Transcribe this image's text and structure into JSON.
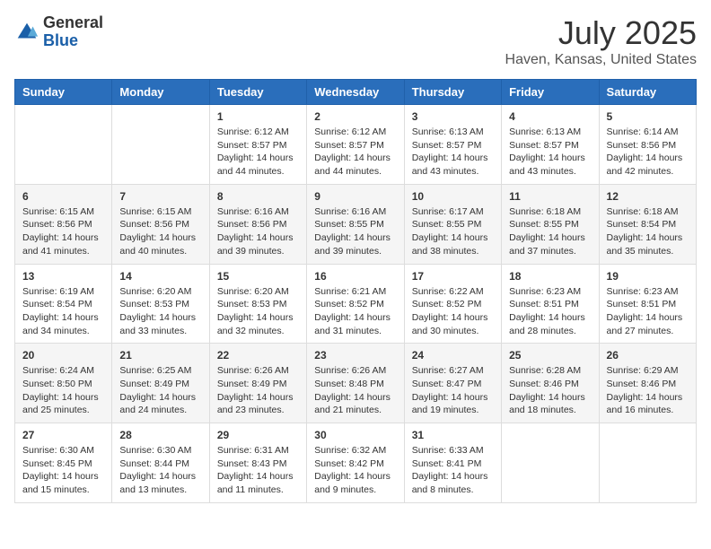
{
  "logo": {
    "general": "General",
    "blue": "Blue"
  },
  "title": "July 2025",
  "subtitle": "Haven, Kansas, United States",
  "days_of_week": [
    "Sunday",
    "Monday",
    "Tuesday",
    "Wednesday",
    "Thursday",
    "Friday",
    "Saturday"
  ],
  "weeks": [
    [
      {
        "day": "",
        "content": ""
      },
      {
        "day": "",
        "content": ""
      },
      {
        "day": "1",
        "content": "Sunrise: 6:12 AM\nSunset: 8:57 PM\nDaylight: 14 hours and 44 minutes."
      },
      {
        "day": "2",
        "content": "Sunrise: 6:12 AM\nSunset: 8:57 PM\nDaylight: 14 hours and 44 minutes."
      },
      {
        "day": "3",
        "content": "Sunrise: 6:13 AM\nSunset: 8:57 PM\nDaylight: 14 hours and 43 minutes."
      },
      {
        "day": "4",
        "content": "Sunrise: 6:13 AM\nSunset: 8:57 PM\nDaylight: 14 hours and 43 minutes."
      },
      {
        "day": "5",
        "content": "Sunrise: 6:14 AM\nSunset: 8:56 PM\nDaylight: 14 hours and 42 minutes."
      }
    ],
    [
      {
        "day": "6",
        "content": "Sunrise: 6:15 AM\nSunset: 8:56 PM\nDaylight: 14 hours and 41 minutes."
      },
      {
        "day": "7",
        "content": "Sunrise: 6:15 AM\nSunset: 8:56 PM\nDaylight: 14 hours and 40 minutes."
      },
      {
        "day": "8",
        "content": "Sunrise: 6:16 AM\nSunset: 8:56 PM\nDaylight: 14 hours and 39 minutes."
      },
      {
        "day": "9",
        "content": "Sunrise: 6:16 AM\nSunset: 8:55 PM\nDaylight: 14 hours and 39 minutes."
      },
      {
        "day": "10",
        "content": "Sunrise: 6:17 AM\nSunset: 8:55 PM\nDaylight: 14 hours and 38 minutes."
      },
      {
        "day": "11",
        "content": "Sunrise: 6:18 AM\nSunset: 8:55 PM\nDaylight: 14 hours and 37 minutes."
      },
      {
        "day": "12",
        "content": "Sunrise: 6:18 AM\nSunset: 8:54 PM\nDaylight: 14 hours and 35 minutes."
      }
    ],
    [
      {
        "day": "13",
        "content": "Sunrise: 6:19 AM\nSunset: 8:54 PM\nDaylight: 14 hours and 34 minutes."
      },
      {
        "day": "14",
        "content": "Sunrise: 6:20 AM\nSunset: 8:53 PM\nDaylight: 14 hours and 33 minutes."
      },
      {
        "day": "15",
        "content": "Sunrise: 6:20 AM\nSunset: 8:53 PM\nDaylight: 14 hours and 32 minutes."
      },
      {
        "day": "16",
        "content": "Sunrise: 6:21 AM\nSunset: 8:52 PM\nDaylight: 14 hours and 31 minutes."
      },
      {
        "day": "17",
        "content": "Sunrise: 6:22 AM\nSunset: 8:52 PM\nDaylight: 14 hours and 30 minutes."
      },
      {
        "day": "18",
        "content": "Sunrise: 6:23 AM\nSunset: 8:51 PM\nDaylight: 14 hours and 28 minutes."
      },
      {
        "day": "19",
        "content": "Sunrise: 6:23 AM\nSunset: 8:51 PM\nDaylight: 14 hours and 27 minutes."
      }
    ],
    [
      {
        "day": "20",
        "content": "Sunrise: 6:24 AM\nSunset: 8:50 PM\nDaylight: 14 hours and 25 minutes."
      },
      {
        "day": "21",
        "content": "Sunrise: 6:25 AM\nSunset: 8:49 PM\nDaylight: 14 hours and 24 minutes."
      },
      {
        "day": "22",
        "content": "Sunrise: 6:26 AM\nSunset: 8:49 PM\nDaylight: 14 hours and 23 minutes."
      },
      {
        "day": "23",
        "content": "Sunrise: 6:26 AM\nSunset: 8:48 PM\nDaylight: 14 hours and 21 minutes."
      },
      {
        "day": "24",
        "content": "Sunrise: 6:27 AM\nSunset: 8:47 PM\nDaylight: 14 hours and 19 minutes."
      },
      {
        "day": "25",
        "content": "Sunrise: 6:28 AM\nSunset: 8:46 PM\nDaylight: 14 hours and 18 minutes."
      },
      {
        "day": "26",
        "content": "Sunrise: 6:29 AM\nSunset: 8:46 PM\nDaylight: 14 hours and 16 minutes."
      }
    ],
    [
      {
        "day": "27",
        "content": "Sunrise: 6:30 AM\nSunset: 8:45 PM\nDaylight: 14 hours and 15 minutes."
      },
      {
        "day": "28",
        "content": "Sunrise: 6:30 AM\nSunset: 8:44 PM\nDaylight: 14 hours and 13 minutes."
      },
      {
        "day": "29",
        "content": "Sunrise: 6:31 AM\nSunset: 8:43 PM\nDaylight: 14 hours and 11 minutes."
      },
      {
        "day": "30",
        "content": "Sunrise: 6:32 AM\nSunset: 8:42 PM\nDaylight: 14 hours and 9 minutes."
      },
      {
        "day": "31",
        "content": "Sunrise: 6:33 AM\nSunset: 8:41 PM\nDaylight: 14 hours and 8 minutes."
      },
      {
        "day": "",
        "content": ""
      },
      {
        "day": "",
        "content": ""
      }
    ]
  ]
}
